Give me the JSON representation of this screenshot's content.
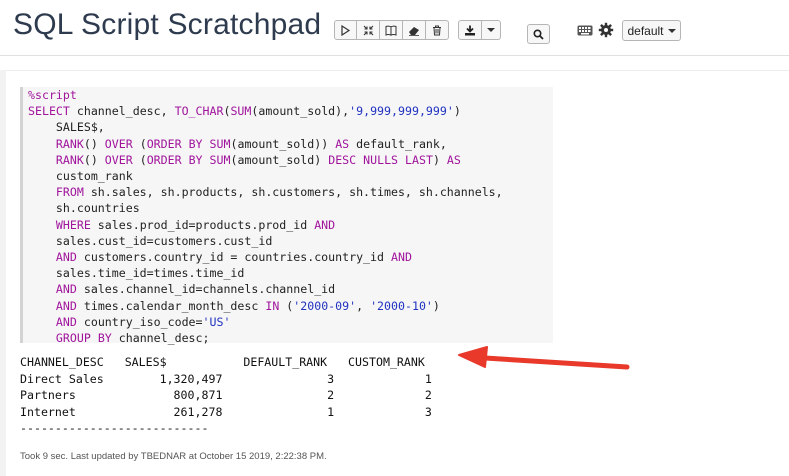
{
  "header": {
    "title": "SQL Script Scratchpad",
    "mode_select_value": "default"
  },
  "toolbar": {
    "icons": [
      "run-icon",
      "expand-icon",
      "book-icon",
      "eraser-icon",
      "trash-icon",
      "download-icon",
      "chevron-down-icon",
      "search-icon",
      "keyboard-icon",
      "gear-icon"
    ]
  },
  "editor": {
    "lines": [
      "%script",
      "SELECT channel_desc, TO_CHAR(SUM(amount_sold),'9,999,999,999')",
      "    SALES$,",
      "    RANK() OVER (ORDER BY SUM(amount_sold)) AS default_rank,",
      "    RANK() OVER (ORDER BY SUM(amount_sold) DESC NULLS LAST) AS",
      "    custom_rank",
      "    FROM sh.sales, sh.products, sh.customers, sh.times, sh.channels,",
      "    sh.countries",
      "    WHERE sales.prod_id=products.prod_id AND",
      "    sales.cust_id=customers.cust_id",
      "    AND customers.country_id = countries.country_id AND",
      "    sales.time_id=times.time_id",
      "    AND sales.channel_id=channels.channel_id",
      "    AND times.calendar_month_desc IN ('2000-09', '2000-10')",
      "    AND country_iso_code='US'",
      "    GROUP BY channel_desc;"
    ]
  },
  "result": {
    "header": "CHANNEL_DESC   SALES$           DEFAULT_RANK   CUSTOM_RANK",
    "rows": [
      "Direct Sales        1,320,497               3             1",
      "Partners              800,871               2             2",
      "Internet              261,278               1             3"
    ],
    "separator": "---------------------------"
  },
  "status": {
    "text": "Took 9 sec. Last updated by TBEDNAR at October 15 2019, 2:22:38 PM."
  },
  "colors": {
    "keyword": "#a0149c",
    "string": "#2032c0",
    "arrow": "#e8392b"
  }
}
